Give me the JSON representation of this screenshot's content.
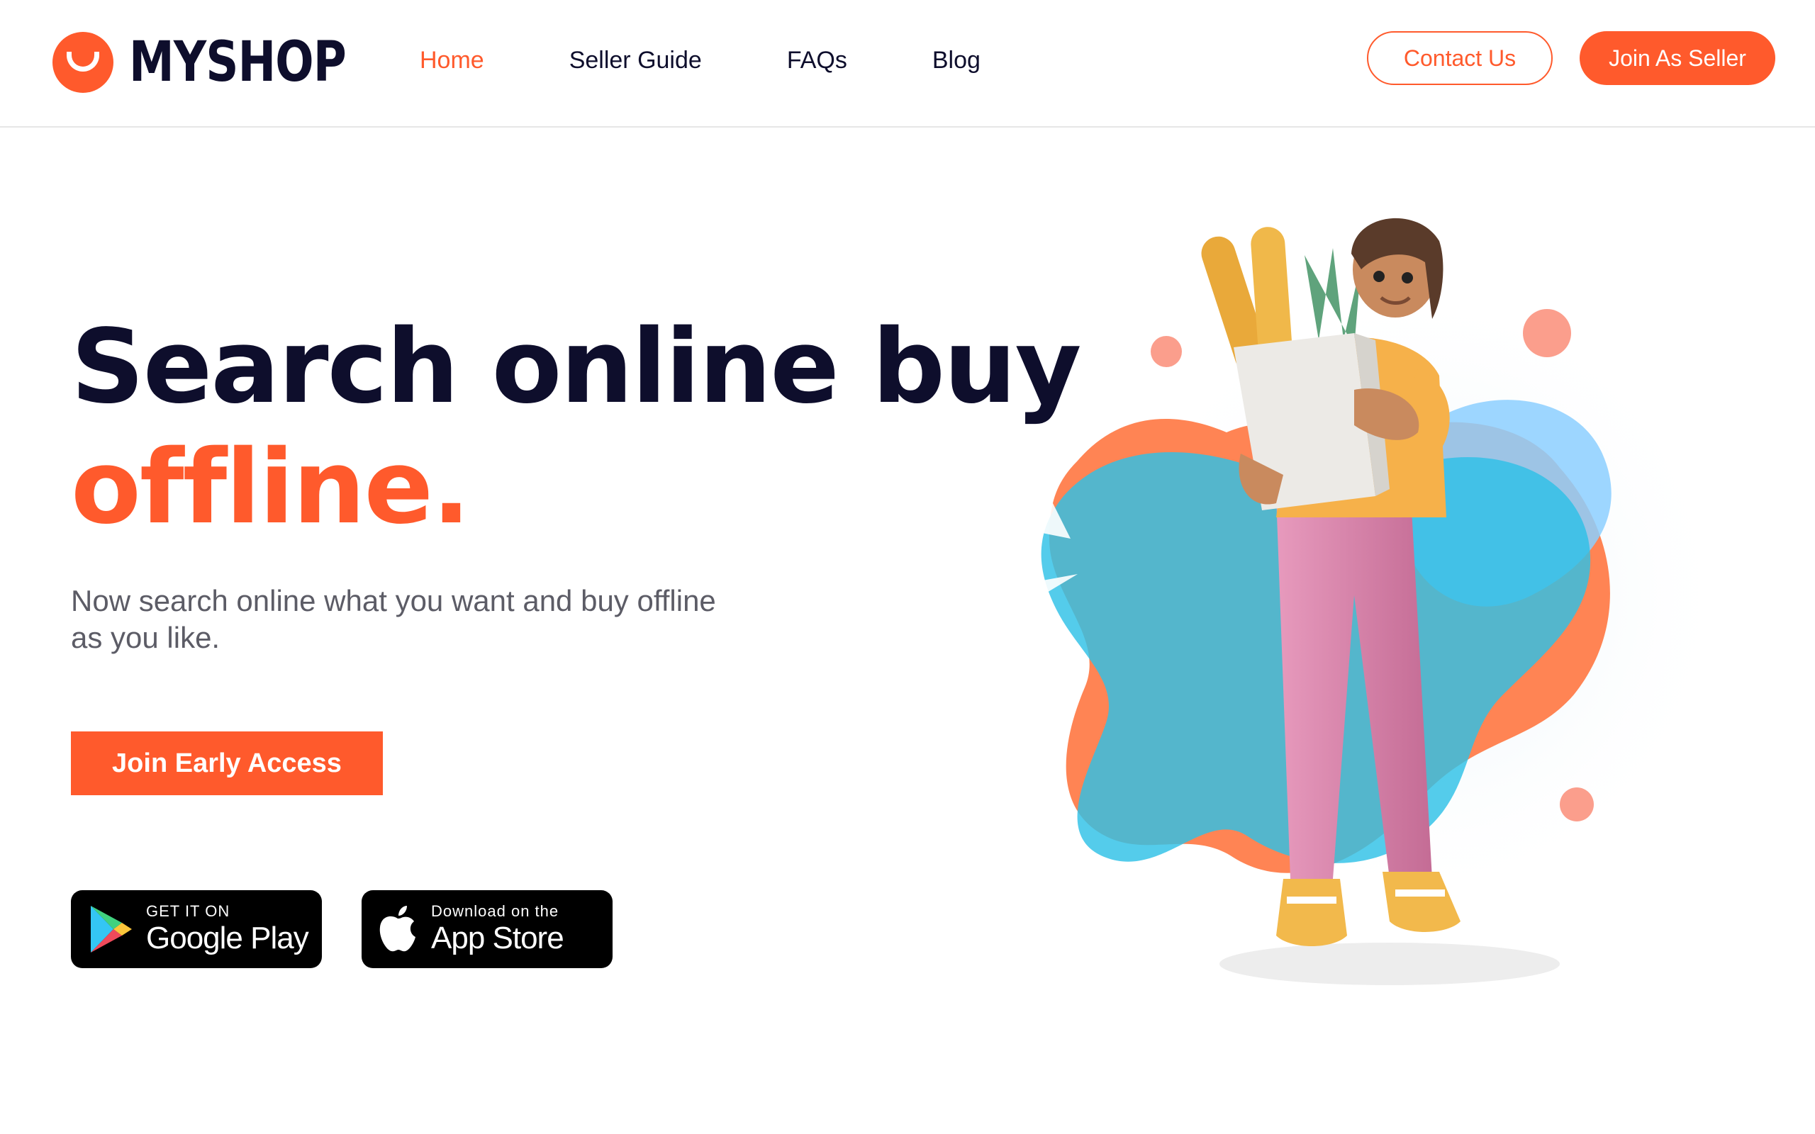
{
  "brand": {
    "name": "MYSHOP",
    "color": "#ff5a2c"
  },
  "nav": {
    "items": [
      {
        "label": "Home",
        "active": true
      },
      {
        "label": "Seller Guide",
        "active": false
      },
      {
        "label": "FAQs",
        "active": false
      },
      {
        "label": "Blog",
        "active": false
      }
    ]
  },
  "header": {
    "contact_label": "Contact Us",
    "seller_label": "Join As Seller"
  },
  "hero": {
    "title_line1": "Search online buy",
    "title_line2": "offline.",
    "subtitle": "Now search online what you want and buy offline as you like.",
    "cta_label": "Join Early Access"
  },
  "stores": {
    "google": {
      "small": "GET IT ON",
      "big": "Google Play"
    },
    "apple": {
      "small": "Download on the",
      "big": "App Store"
    }
  },
  "colors": {
    "accent": "#ff5a2c",
    "heading": "#0e0e2c",
    "text": "#5c5c66",
    "blob_blue": "#44bfe0",
    "blob_orange": "#ff7a45",
    "dot": "#fa8d78"
  }
}
